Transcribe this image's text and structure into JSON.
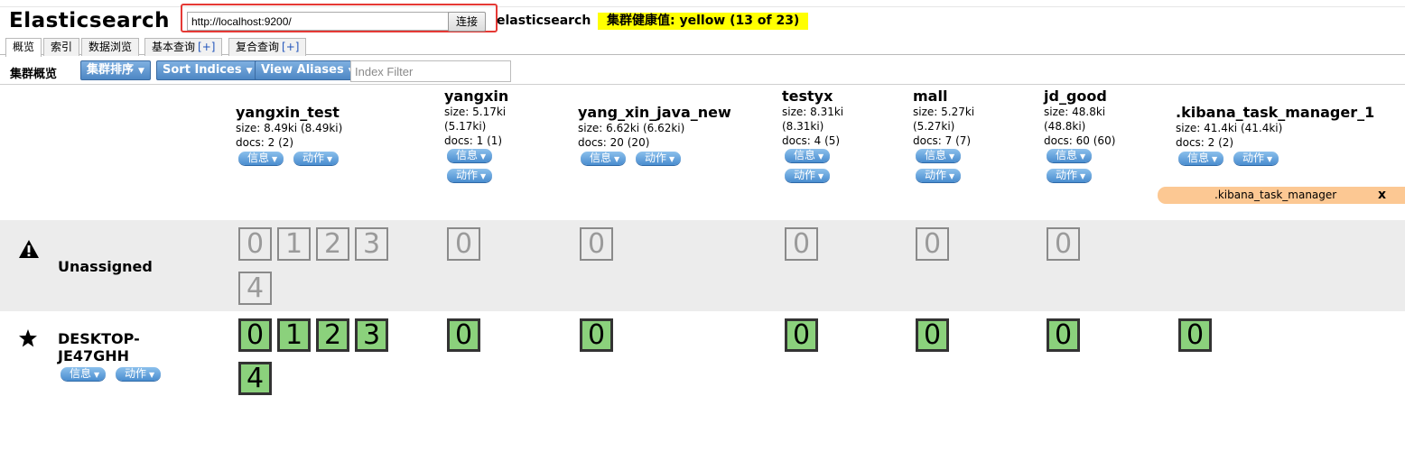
{
  "app": {
    "title": "Elasticsearch",
    "url_value": "http://localhost:9200/",
    "connect_label": "连接",
    "cluster_name": "elasticsearch",
    "health_text": "集群健康值: yellow (13 of 23)",
    "health_color": "#ffff00"
  },
  "tabs": [
    {
      "label": "概览",
      "plus": ""
    },
    {
      "label": "索引",
      "plus": ""
    },
    {
      "label": "数据浏览",
      "plus": ""
    },
    {
      "label": "基本查询",
      "plus": "[+]"
    },
    {
      "label": "复合查询",
      "plus": "[+]"
    }
  ],
  "toolbar": {
    "title": "集群概览",
    "buttons": [
      "集群排序",
      "Sort Indices",
      "View Aliases"
    ],
    "filter_placeholder": "Index Filter"
  },
  "labels": {
    "info": "信息",
    "action": "动作"
  },
  "indices": [
    {
      "name": "yangxin_test",
      "size": "size: 8.49ki (8.49ki)",
      "docs": "docs: 2 (2)"
    },
    {
      "name": "yangxin",
      "size1": "size: 5.17ki",
      "size2": "(5.17ki)",
      "docs": "docs: 1 (1)"
    },
    {
      "name": "yang_xin_java_new",
      "size": "size: 6.62ki (6.62ki)",
      "docs": "docs: 20 (20)"
    },
    {
      "name": "testyx",
      "size1": "size: 8.31ki",
      "size2": "(8.31ki)",
      "docs": "docs: 4 (5)"
    },
    {
      "name": "mall",
      "size1": "size: 5.27ki",
      "size2": "(5.27ki)",
      "docs": "docs: 7 (7)"
    },
    {
      "name": "jd_good",
      "size1": "size: 48.8ki",
      "size2": "(48.8ki)",
      "docs": "docs: 60 (60)"
    },
    {
      "name": ".kibana_task_manager_1",
      "size": "size: 41.4ki (41.4ki)",
      "docs": "docs: 2 (2)"
    }
  ],
  "alias": {
    "name": ".kibana_task_manager",
    "close": "x"
  },
  "rows": {
    "unassigned": {
      "icon": "warning-icon",
      "label": "Unassigned"
    },
    "node": {
      "icon": "star-icon",
      "label_line1": "DESKTOP-",
      "label_line2": "JE47GHH"
    }
  },
  "shards": {
    "digits": [
      "0",
      "1",
      "2",
      "3",
      "4"
    ],
    "assigned_color": "#8bd17c",
    "unassigned_color": "#9a9a9a"
  }
}
